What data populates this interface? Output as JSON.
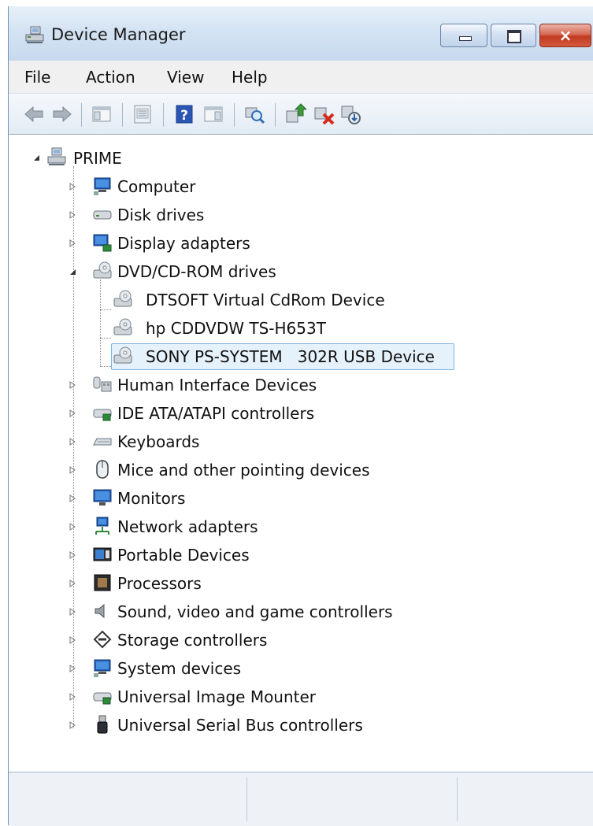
{
  "window": {
    "title": "Device Manager",
    "controls": {
      "minimize": "minimize",
      "maximize": "maximize",
      "close": "×"
    }
  },
  "menu": {
    "items": [
      "File",
      "Action",
      "View",
      "Help"
    ]
  },
  "toolbar": {
    "buttons": [
      "back-arrow-icon",
      "forward-arrow-icon",
      "show-hide-console-tree-icon",
      "properties-icon",
      "help-icon",
      "show-hide-action-pane-icon",
      "scan-hardware-icon",
      "update-driver-icon",
      "disable-device-icon",
      "uninstall-device-icon"
    ]
  },
  "tree": {
    "root": "PRIME",
    "categories": [
      "Computer",
      "Disk drives",
      "Display adapters",
      "DVD/CD-ROM drives",
      "Human Interface Devices",
      "IDE ATA/ATAPI controllers",
      "Keyboards",
      "Mice and other pointing devices",
      "Monitors",
      "Network adapters",
      "Portable Devices",
      "Processors",
      "Sound, video and game controllers",
      "Storage controllers",
      "System devices",
      "Universal Image Mounter",
      "Universal Serial Bus controllers"
    ],
    "dvd_children": [
      "DTSOFT Virtual CdRom Device",
      "hp CDDVDW TS-H653T",
      "SONY PS-SYSTEM   302R USB Device"
    ],
    "selected": "SONY PS-SYSTEM   302R USB Device"
  },
  "statusbar": {
    "panes": [
      "",
      "",
      ""
    ]
  }
}
